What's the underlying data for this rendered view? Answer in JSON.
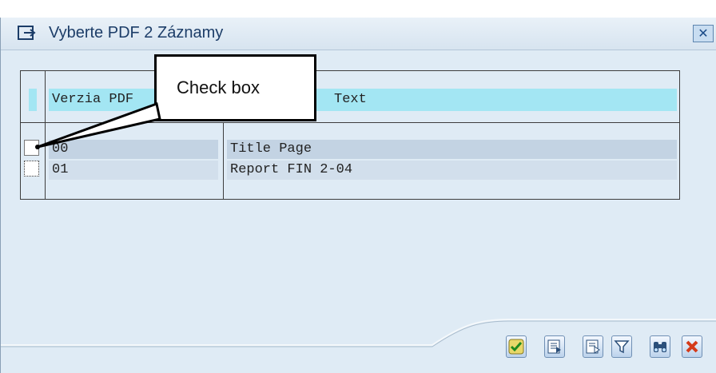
{
  "window": {
    "title": "Vyberte PDF 2 Záznamy",
    "close_glyph": "✕"
  },
  "table": {
    "headers": [
      "Verzia PDF",
      "Text"
    ],
    "rows": [
      {
        "version": "00",
        "text": "Title Page"
      },
      {
        "version": "01",
        "text": "Report FIN 2-04"
      }
    ]
  },
  "callout": {
    "label": "Check box"
  },
  "toolbar": {
    "buttons": [
      "checkmark-icon",
      "select-all-icon",
      "deselect-all-icon",
      "filter-icon",
      "binoculars-icon",
      "cancel-icon"
    ]
  },
  "colors": {
    "header_bg": "#a3e6f3",
    "dialog_bg": "#dfebf5",
    "title_text": "#1c3d68"
  }
}
